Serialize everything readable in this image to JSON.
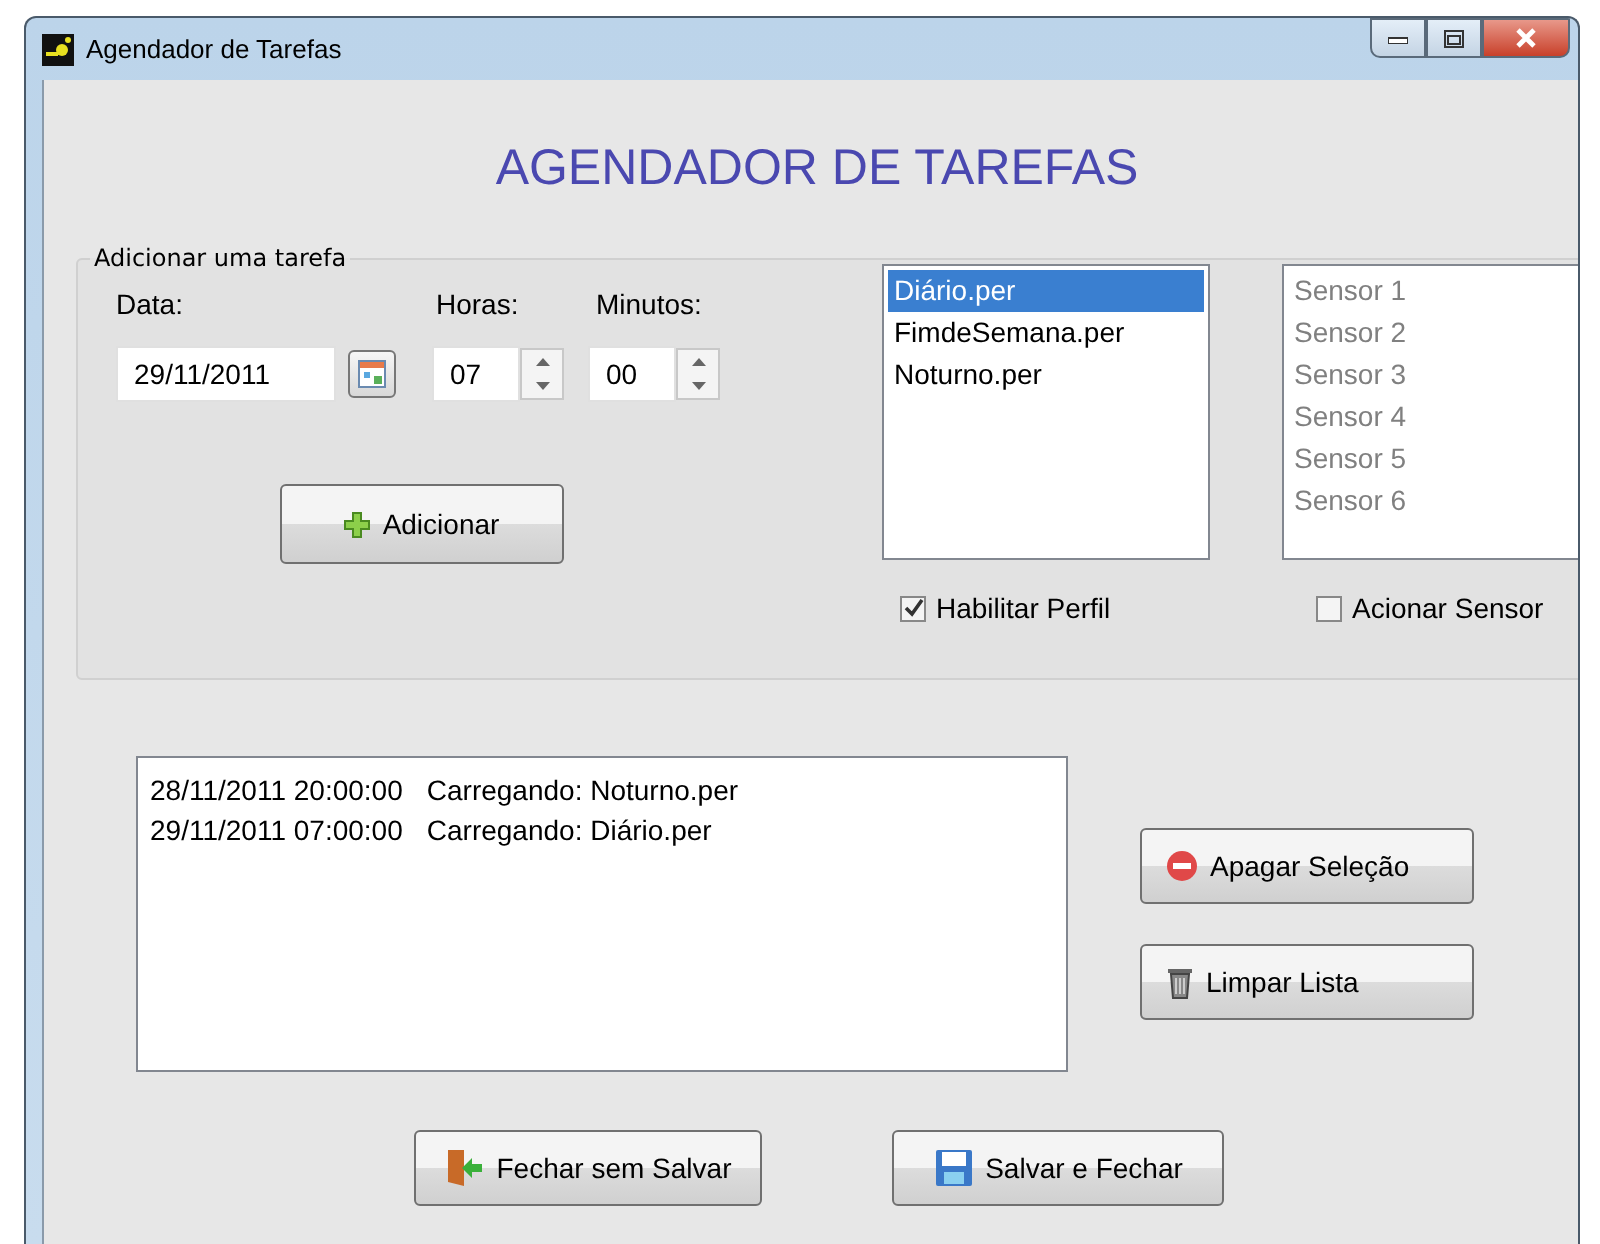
{
  "window": {
    "title": "Agendador de Tarefas"
  },
  "heading": "AGENDADOR DE TAREFAS",
  "task_group": {
    "legend": "Adicionar uma tarefa",
    "date": {
      "label": "Data:",
      "value": "29/11/2011"
    },
    "hours": {
      "label": "Horas:",
      "value": "07"
    },
    "minutes": {
      "label": "Minutos:",
      "value": "00"
    },
    "add_button": "Adicionar",
    "profiles": [
      {
        "label": "Diário.per",
        "selected": true
      },
      {
        "label": "FimdeSemana.per",
        "selected": false
      },
      {
        "label": "Noturno.per",
        "selected": false
      }
    ],
    "sensors": [
      {
        "label": "Sensor 1",
        "disabled": true
      },
      {
        "label": "Sensor 2",
        "disabled": true
      },
      {
        "label": "Sensor 3",
        "disabled": true
      },
      {
        "label": "Sensor 4",
        "disabled": true
      },
      {
        "label": "Sensor 5",
        "disabled": true
      },
      {
        "label": "Sensor 6",
        "disabled": true
      }
    ],
    "enable_profile": {
      "label": "Habilitar Perfil",
      "checked": true
    },
    "trigger_sensor": {
      "label": "Acionar Sensor",
      "checked": false
    }
  },
  "schedule": [
    {
      "timestamp": "28/11/2011 20:00:00",
      "message": "Carregando: Noturno.per"
    },
    {
      "timestamp": "29/11/2011 07:00:00",
      "message": "Carregando: Diário.per"
    }
  ],
  "delete_button": "Apagar Seleção",
  "clear_button": "Limpar Lista",
  "buttons": [
    {
      "label": "Fechar sem Salvar",
      "kind": "close"
    },
    {
      "label": "Salvar e Fechar",
      "kind": "save"
    }
  ]
}
